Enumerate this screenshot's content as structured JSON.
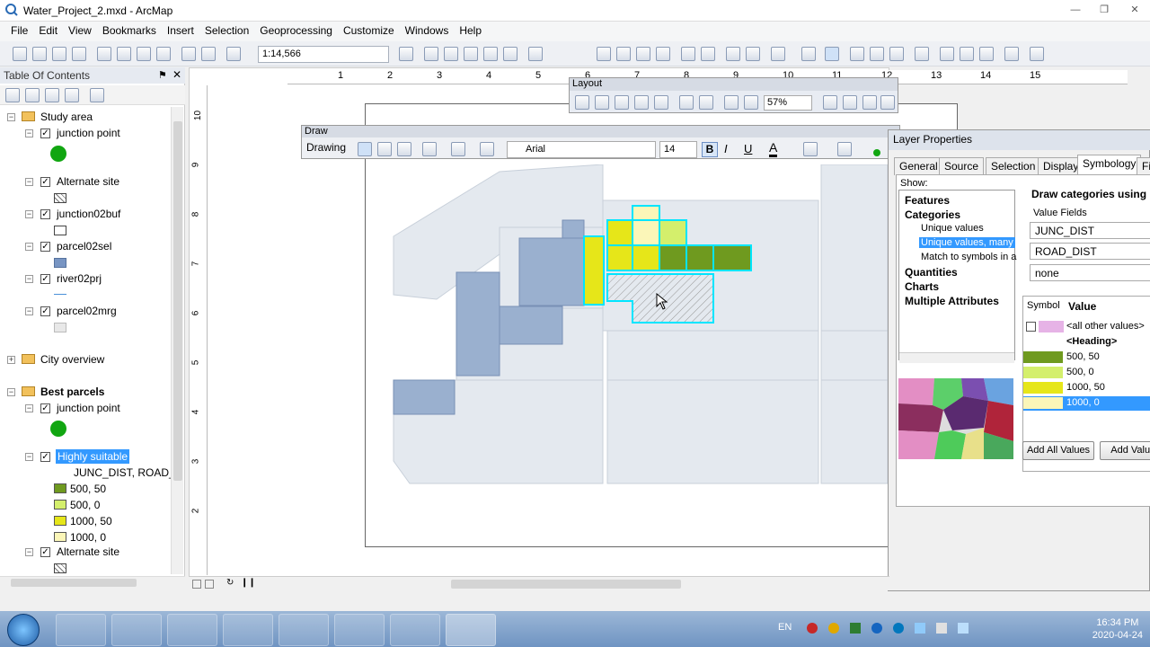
{
  "window": {
    "title": "Water_Project_2.mxd - ArcMap"
  },
  "menu": [
    "File",
    "Edit",
    "View",
    "Bookmarks",
    "Insert",
    "Selection",
    "Geoprocessing",
    "Customize",
    "Windows",
    "Help"
  ],
  "toolbar": {
    "scale": "1:14,566"
  },
  "toc": {
    "title": "Table Of Contents",
    "items": [
      {
        "label": "Study area",
        "kind": "group"
      },
      {
        "label": "junction point"
      },
      {
        "label": "Alternate site"
      },
      {
        "label": "junction02buf"
      },
      {
        "label": "parcel02sel"
      },
      {
        "label": "river02prj"
      },
      {
        "label": "parcel02mrg"
      },
      {
        "label": "City overview",
        "kind": "group"
      },
      {
        "label": "Best parcels",
        "kind": "group"
      },
      {
        "label": "junction point"
      },
      {
        "label": "Highly suitable"
      },
      {
        "label": "JUNC_DIST, ROAD_I"
      },
      {
        "label": "500, 50"
      },
      {
        "label": "500, 0"
      },
      {
        "label": "1000, 50"
      },
      {
        "label": "1000, 0"
      },
      {
        "label": "Alternate site"
      }
    ]
  },
  "ruler": {
    "top": [
      "1",
      "2",
      "3",
      "4",
      "5",
      "6",
      "7",
      "8",
      "9",
      "10",
      "11",
      "12",
      "13",
      "14",
      "15"
    ],
    "left": [
      "10",
      "9",
      "8",
      "7",
      "6",
      "5",
      "4",
      "3",
      "2"
    ]
  },
  "layout_toolbar": {
    "title": "Layout",
    "zoom": "57%"
  },
  "draw_toolbar": {
    "title": "Draw",
    "drawing": "Drawing",
    "font": "Arial",
    "size": "14",
    "bold": "B",
    "italic": "I",
    "underline": "U",
    "font_color": "A"
  },
  "layer_properties": {
    "title": "Layer Properties",
    "tabs": [
      "General",
      "Source",
      "Selection",
      "Display",
      "Symbology",
      "Fiel"
    ],
    "active_tab": "Symbology",
    "show": "Show:",
    "show_items": [
      "Features",
      "Categories",
      "Unique values",
      "Unique values, many",
      "Match to symbols in a",
      "Quantities",
      "Charts",
      "Multiple Attributes"
    ],
    "draw_text": "Draw categories using un",
    "value_fields": "Value Fields",
    "fields": [
      "JUNC_DIST",
      "ROAD_DIST",
      "none"
    ],
    "symbol_header": "Symbol",
    "value_header": "Value",
    "rows": [
      {
        "label": "<all other values>",
        "color": "#e6b3e6"
      },
      {
        "label": "<Heading>"
      },
      {
        "label": "500, 50",
        "color": "#6f9a1f"
      },
      {
        "label": "500, 0",
        "color": "#d4ef6c"
      },
      {
        "label": "1000, 50",
        "color": "#e6e619"
      },
      {
        "label": "1000, 0",
        "color": "#fbf6b8"
      }
    ],
    "add_all": "Add All Values",
    "add": "Add Values"
  },
  "clock": {
    "time": "16:34 PM",
    "date": "2020-04-24",
    "lang": "EN"
  }
}
